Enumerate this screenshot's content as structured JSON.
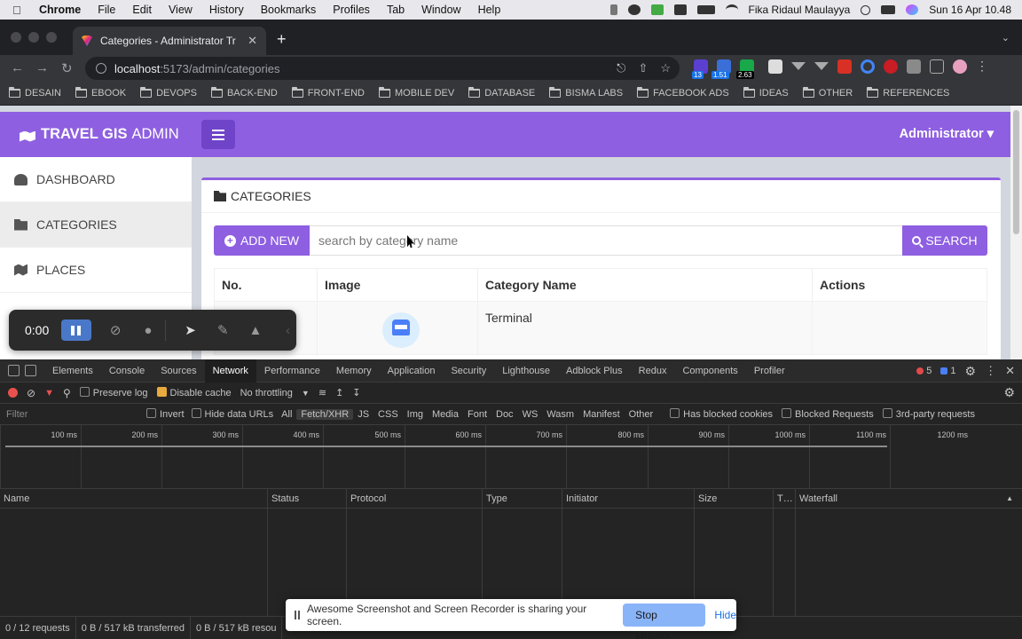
{
  "menubar": {
    "app": "Chrome",
    "items": [
      "File",
      "Edit",
      "View",
      "History",
      "Bookmarks",
      "Profiles",
      "Tab",
      "Window",
      "Help"
    ],
    "user": "Fika Ridaul Maulayya",
    "datetime": "Sun 16 Apr  10.48"
  },
  "browser": {
    "tab_title": "Categories - Administrator Tr",
    "url_host": "localhost",
    "url_path": ":5173/admin/categories",
    "ext_badges": [
      "13",
      "1.51",
      "2.63"
    ],
    "bookmarks": [
      "DESAIN",
      "EBOOK",
      "DEVOPS",
      "BACK-END",
      "FRONT-END",
      "MOBILE DEV",
      "DATABASE",
      "BISMA LABS",
      "FACEBOOK ADS",
      "IDEAS",
      "OTHER",
      "REFERENCES"
    ]
  },
  "app": {
    "brand_bold": "TRAVEL GIS",
    "brand_light": "ADMIN",
    "user_menu": "Administrator ▾",
    "sidebar": [
      "DASHBOARD",
      "CATEGORIES",
      "PLACES"
    ],
    "card_title": "CATEGORIES",
    "add_button": "ADD NEW",
    "search_placeholder": "search by category name",
    "search_button": "SEARCH",
    "table": {
      "headers": [
        "No.",
        "Image",
        "Category Name",
        "Actions"
      ],
      "rows": [
        {
          "no": "",
          "name": "Terminal"
        }
      ]
    }
  },
  "recorder": {
    "time": "0:00"
  },
  "devtools": {
    "tabs": [
      "Elements",
      "Console",
      "Sources",
      "Network",
      "Performance",
      "Memory",
      "Application",
      "Security",
      "Lighthouse",
      "Adblock Plus",
      "Redux",
      "Components",
      "Profiler"
    ],
    "error_count": "5",
    "message_count": "1",
    "preserve_log": "Preserve log",
    "disable_cache": "Disable cache",
    "throttling": "No throttling",
    "filter_placeholder": "Filter",
    "invert": "Invert",
    "hide_data_urls": "Hide data URLs",
    "types": [
      "All",
      "Fetch/XHR",
      "JS",
      "CSS",
      "Img",
      "Media",
      "Font",
      "Doc",
      "WS",
      "Wasm",
      "Manifest",
      "Other"
    ],
    "has_blocked_cookies": "Has blocked cookies",
    "blocked_requests": "Blocked Requests",
    "third_party": "3rd-party requests",
    "timeline_ticks": [
      "100 ms",
      "200 ms",
      "300 ms",
      "400 ms",
      "500 ms",
      "600 ms",
      "700 ms",
      "800 ms",
      "900 ms",
      "1000 ms",
      "1100 ms",
      "1200 ms"
    ],
    "columns": [
      "Name",
      "Status",
      "Protocol",
      "Type",
      "Initiator",
      "Size",
      "T…",
      "Waterfall"
    ],
    "status": [
      "0 / 12 requests",
      "0 B / 517 kB transferred",
      "0 B / 517 kB resou"
    ]
  },
  "share_bar": {
    "message": "Awesome Screenshot and Screen Recorder is sharing your screen.",
    "stop": "Stop sharing",
    "hide": "Hide"
  }
}
